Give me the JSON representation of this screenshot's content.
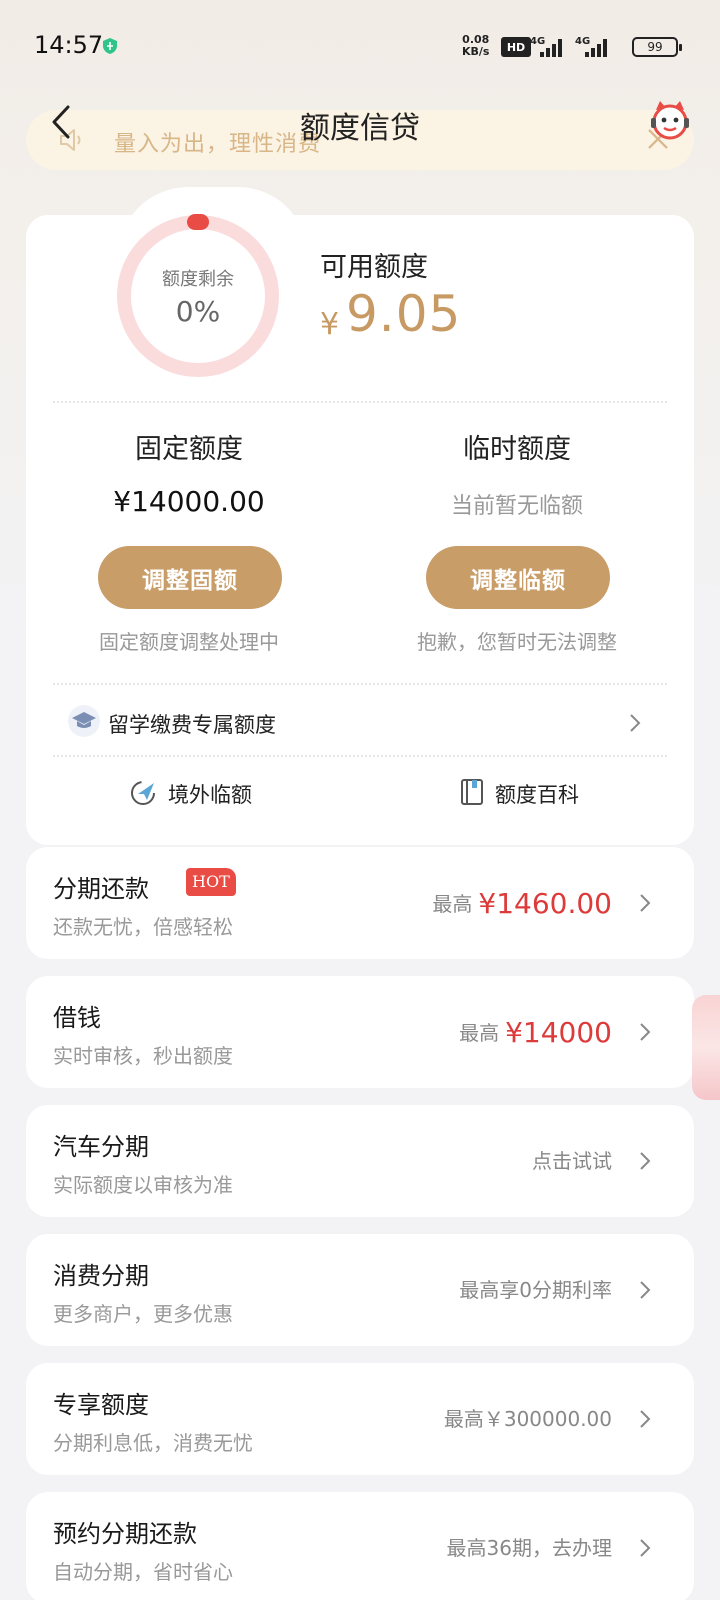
{
  "status_bar": {
    "time": "14:57",
    "speed_value": "0.08",
    "speed_unit": "KB/s",
    "hd": "HD",
    "network_1": "4G",
    "network_2": "4G",
    "battery": "99"
  },
  "header": {
    "title": "额度信贷",
    "notice_text": "量入为出，理性消费"
  },
  "credit_summary": {
    "ring_label": "额度剩余",
    "ring_value": "0%",
    "ring_remaining_fraction": 0,
    "available_label": "可用额度",
    "currency": "¥",
    "available_value": "9.05"
  },
  "fixed_limit": {
    "title": "固定额度",
    "amount": "¥14000.00",
    "button": "调整固额",
    "note": "固定额度调整处理中"
  },
  "temp_limit": {
    "title": "临时额度",
    "empty_text": "当前暂无临额",
    "button": "调整临额",
    "note": "抱歉，您暂时无法调整"
  },
  "study_abroad": {
    "label": "留学缴费专属额度"
  },
  "quick_links": [
    {
      "label": "境外临额",
      "icon": "plane-icon"
    },
    {
      "label": "额度百科",
      "icon": "book-icon"
    }
  ],
  "services": [
    {
      "title": "分期还款",
      "subtitle": "还款无忧，倍感轻松",
      "right_prefix": "最高",
      "right_amount": "¥1460.00",
      "badge": "HOT"
    },
    {
      "title": "借钱",
      "subtitle": "实时审核，秒出额度",
      "right_prefix": "最高",
      "right_amount": "¥14000"
    },
    {
      "title": "汽车分期",
      "subtitle": "实际额度以审核为准",
      "right_text": "点击试试"
    },
    {
      "title": "消费分期",
      "subtitle": "更多商户，更多优惠",
      "right_text": "最高享0分期利率"
    },
    {
      "title": "专享额度",
      "subtitle": "分期利息低，消费无忧",
      "right_text": "最高￥300000.00"
    },
    {
      "title": "预约分期还款",
      "subtitle": "自动分期，省时省心",
      "right_text": "最高36期，去办理"
    }
  ],
  "colors": {
    "gold": "#c89d68",
    "red": "#dd3a3a",
    "ring_track": "#fbdcdc",
    "notice_bg": "#fbf3e3"
  }
}
